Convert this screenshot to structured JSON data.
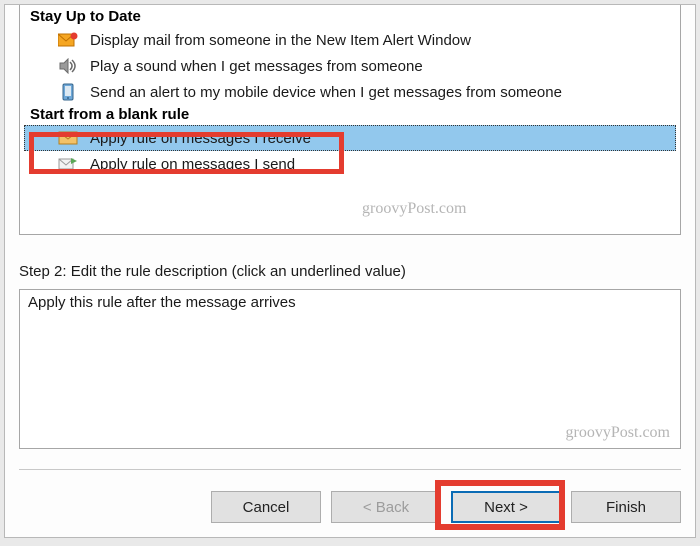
{
  "sections": {
    "stay_up_to_date": {
      "header": "Stay Up to Date",
      "items": [
        {
          "label": "Display mail from someone in the New Item Alert Window"
        },
        {
          "label": "Play a sound when I get messages from someone"
        },
        {
          "label": "Send an alert to my mobile device when I get messages from someone"
        }
      ]
    },
    "blank_rule": {
      "header": "Start from a blank rule",
      "items": [
        {
          "label": "Apply rule on messages I receive",
          "selected": true
        },
        {
          "label": "Apply rule on messages I send"
        }
      ]
    }
  },
  "step2": {
    "label": "Step 2: Edit the rule description (click an underlined value)",
    "description": "Apply this rule after the message arrives"
  },
  "buttons": {
    "cancel": "Cancel",
    "back": "< Back",
    "next": "Next >",
    "finish": "Finish"
  },
  "watermark": "groovyPost.com"
}
